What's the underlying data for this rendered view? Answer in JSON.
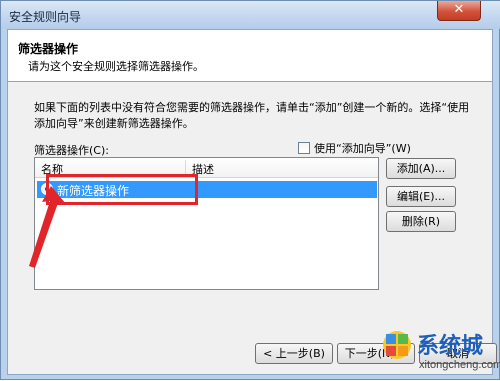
{
  "window": {
    "title": "安全规则向导",
    "close_glyph": "✕"
  },
  "header": {
    "title": "筛选器操作",
    "subtitle": "请为这个安全规则选择筛选器操作。"
  },
  "description": "如果下面的列表中没有符合您需要的筛选器操作，请单击“添加”创建一个新的。选择“使用添加向导”来创建新筛选器操作。",
  "filter_actions": {
    "label": "筛选器操作(C):",
    "use_wizard_label": "使用“添加向导”(W)",
    "use_wizard_checked": false,
    "columns": [
      "名称",
      "描述"
    ],
    "rows": [
      {
        "name": "新筛选器操作",
        "description": "",
        "selected": true
      }
    ]
  },
  "side_buttons": {
    "add": "添加(A)...",
    "edit": "编辑(E)...",
    "delete": "删除(R)"
  },
  "footer_buttons": {
    "back": "< 上一步(B)",
    "next": "下一步(N) >",
    "cancel": "取消"
  },
  "watermark": {
    "brand": "系统城",
    "url": "xitongcheng.com"
  },
  "annotation": {
    "color": "#e0262b"
  }
}
